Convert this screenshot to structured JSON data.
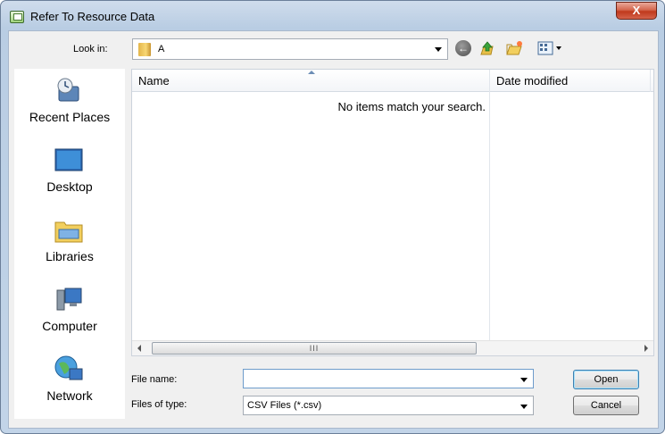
{
  "window": {
    "title": "Refer To Resource Data",
    "close_glyph": "X"
  },
  "toolbar": {
    "look_in_label": "Look in:",
    "look_in_value": "A",
    "icons": [
      "back-icon",
      "up-folder-icon",
      "new-folder-icon",
      "views-menu-icon"
    ]
  },
  "places": [
    {
      "label": "Recent Places",
      "icon": "recent-places-icon"
    },
    {
      "label": "Desktop",
      "icon": "desktop-icon"
    },
    {
      "label": "Libraries",
      "icon": "libraries-icon"
    },
    {
      "label": "Computer",
      "icon": "computer-icon"
    },
    {
      "label": "Network",
      "icon": "network-icon"
    }
  ],
  "file_list": {
    "columns": [
      "Name",
      "Date modified"
    ],
    "empty_message": "No items match your search.",
    "scrollbar_grip": "III"
  },
  "form": {
    "file_name_label": "File name:",
    "file_name_value": "",
    "file_type_label": "Files of type:",
    "file_type_value": "CSV Files (*.csv)"
  },
  "buttons": {
    "open": "Open",
    "cancel": "Cancel"
  },
  "colors": {
    "accent": "#3c7fb1",
    "close": "#c0391c"
  }
}
